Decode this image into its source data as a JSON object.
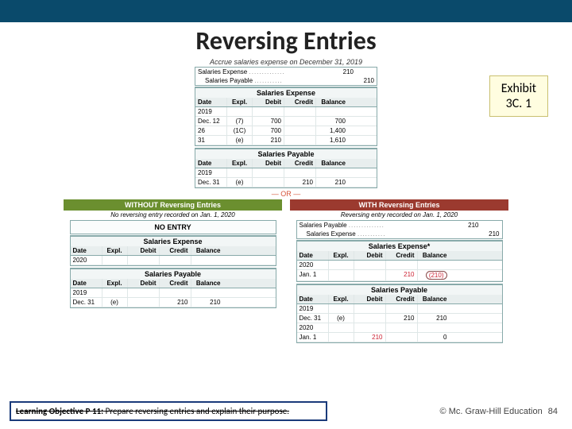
{
  "title": "Reversing Entries",
  "exhibit": {
    "line1": "Exhibit",
    "line2": "3C. 1"
  },
  "top_caption": "Accrue salaries expense on December 31, 2019",
  "top_journal": [
    {
      "label": "Salaries Expense",
      "dots": "..............",
      "debit": "210",
      "credit": ""
    },
    {
      "label": "   Salaries Payable",
      "dots": "...........",
      "debit": "",
      "credit": "210"
    }
  ],
  "ledger_headers": [
    "Date",
    "Expl.",
    "Debit",
    "Credit",
    "Balance"
  ],
  "top_ledger1": {
    "title": "Salaries Expense",
    "year": "2019",
    "rows": [
      {
        "date": "Dec. 12",
        "expl": "(7)",
        "debit": "700",
        "credit": "",
        "bal": "700"
      },
      {
        "date": "26",
        "expl": "(1C)",
        "debit": "700",
        "credit": "",
        "bal": "1,400"
      },
      {
        "date": "31",
        "expl": "(e)",
        "debit": "210",
        "credit": "",
        "bal": "1,610"
      }
    ]
  },
  "top_ledger2": {
    "title": "Salaries Payable",
    "year": "2019",
    "rows": [
      {
        "date": "Dec. 31",
        "expl": "(e)",
        "debit": "",
        "credit": "210",
        "bal": "210"
      }
    ]
  },
  "or_text": "— OR —",
  "without": {
    "head": "WITHOUT Reversing Entries",
    "sub": "No reversing entry recorded on Jan. 1, 2020",
    "noentry": "NO ENTRY",
    "ledger1": {
      "title": "Salaries Expense",
      "year": "2020",
      "rows": []
    },
    "ledger2": {
      "title": "Salaries Payable",
      "year": "2019",
      "rows": [
        {
          "date": "Dec. 31",
          "expl": "(e)",
          "debit": "",
          "credit": "210",
          "bal": "210"
        }
      ]
    }
  },
  "with": {
    "head": "WITH Reversing Entries",
    "sub": "Reversing entry recorded on Jan. 1, 2020",
    "journal": [
      {
        "label": "Salaries Payable",
        "dots": "..............",
        "debit": "210",
        "credit": ""
      },
      {
        "label": "   Salaries Expense",
        "dots": "...........",
        "debit": "",
        "credit": "210"
      }
    ],
    "ledger1": {
      "title": "Salaries Expense*",
      "year": "2020",
      "rows": [
        {
          "date": "Jan. 1",
          "expl": "",
          "debit": "",
          "credit": "210",
          "bal": "(210)",
          "circled": true
        }
      ]
    },
    "ledger2": {
      "title": "Salaries Payable",
      "rows": [
        {
          "year": "2019",
          "date": "Dec. 31",
          "expl": "(e)",
          "debit": "",
          "credit": "210",
          "bal": "210"
        },
        {
          "year": "2020",
          "date": "Jan. 1",
          "expl": "",
          "debit": "210",
          "credit": "",
          "bal": "0"
        }
      ]
    }
  },
  "learning_obj": {
    "prefix": "Learning Objective P 11:",
    "text": " Prepare reversing entries and explain their purpose."
  },
  "copyright": "© Mc. Graw-Hill Education",
  "page_num": "84"
}
